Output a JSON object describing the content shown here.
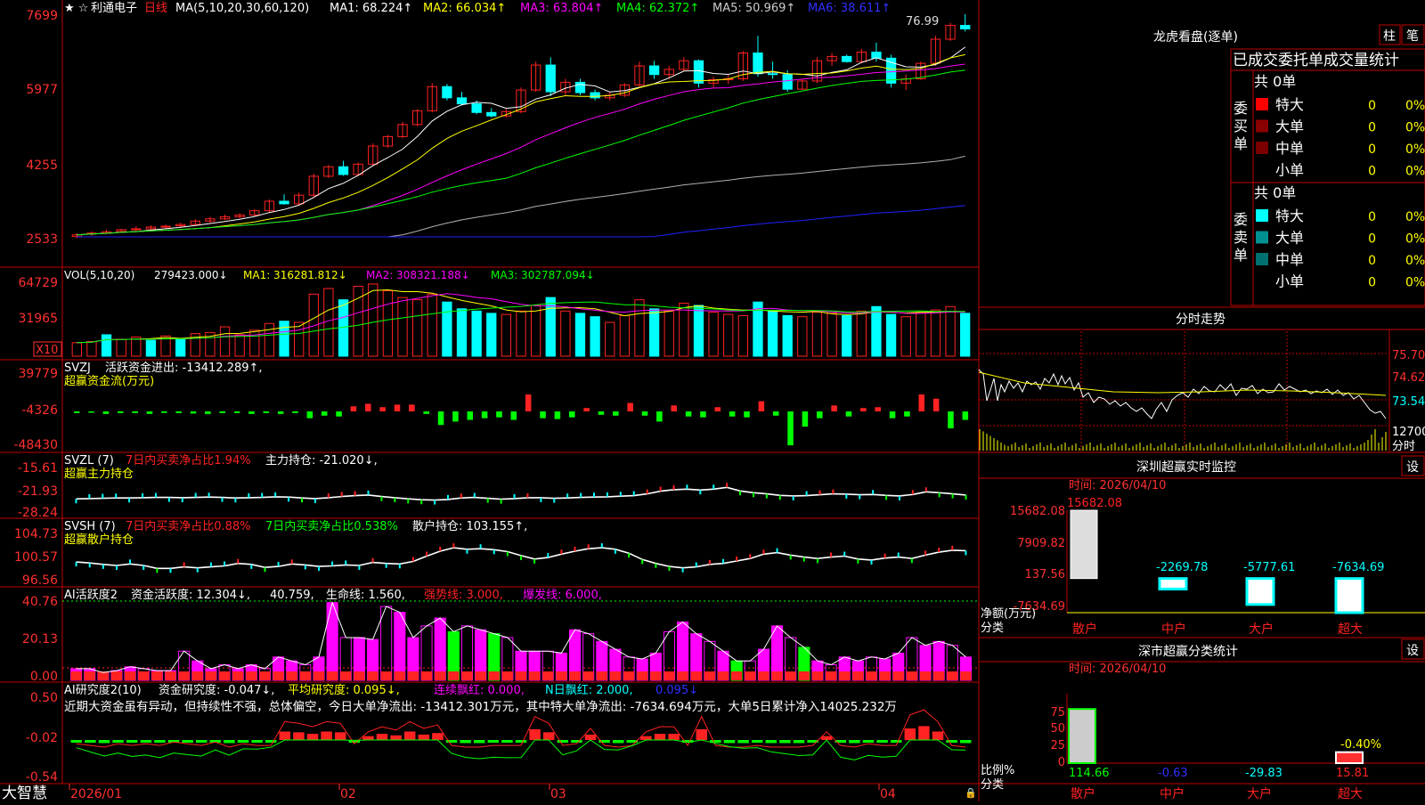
{
  "colors": {
    "up": "#ff2222",
    "down": "#00ffff",
    "panel_border": "#c00000",
    "ma1": "#ffffff",
    "ma2": "#ffff00",
    "ma3": "#ff00ff",
    "ma4": "#00ff00",
    "ma5": "#b0b0b0",
    "ma6": "#2020ff",
    "pink": "#ff00ff",
    "green": "#00ff00",
    "yellow": "#ffff00",
    "cyan": "#00ffff",
    "red": "#ff2222",
    "brown": "#8b0000",
    "teal": "#008080"
  },
  "main_header": {
    "stock_name": "利通电子",
    "period": "日线",
    "ma_params": "MA(5,10,20,30,60,120)",
    "ma1": "MA1: 68.224↑",
    "ma2": "MA2: 66.034↑",
    "ma3": "MA3: 63.804↑",
    "ma4": "MA4: 62.372↑",
    "ma5": "MA5: 50.969↑",
    "ma6": "MA6: 38.611↑",
    "high_label": "76.99"
  },
  "vol_header": {
    "params": "VOL(5,10,20)",
    "value": "279423.000↓",
    "ma1": "MA1: 316281.812↓",
    "ma2": "MA2: 308321.188↓",
    "ma3": "MA3: 302787.094↓",
    "unit": "X10"
  },
  "svzj_header": {
    "name": "SVZJ",
    "label": "活跃资金进出: -13412.289↑,",
    "sub": "超赢资金流(万元)"
  },
  "svzl_header": {
    "name": "SVZL (7)",
    "ratio": "7日内买卖净占比1.94%",
    "hold": "主力持仓: -21.020↓,",
    "sub": "超赢主力持仓"
  },
  "svsh_header": {
    "name": "SVSH (7)",
    "ratio1": "7日内买卖净占比0.88%",
    "ratio2": "7日内买卖净占比0.538%",
    "hold": "散户持仓: 103.155↑,",
    "sub": "超赢散户持仓"
  },
  "ai_header": {
    "name": "AI活跃度2",
    "act": "资金活跃度: 12.304↓,",
    "v2": "40.759,",
    "life": "生命线: 1.560,",
    "strong": "强势线: 3.000,",
    "burst": "爆发线: 6.000,"
  },
  "research_header": {
    "name": "AI研究度2(10)",
    "r1": "资金研究度: -0.047↓,",
    "r2": "平均研究度: 0.095↓,",
    "r3": "连续飘红: 0.000,",
    "r4": "N日飘红: 2.000,",
    "r5": "0.095↓",
    "comment": "近期大资金虽有异动，但持续性不强，总体偏空，今日大单净流出: -13412.301万元，其中特大单净流出: -7634.694万元，大单5日累计净入14025.232万"
  },
  "axes": {
    "price_ticks": [
      "7699",
      "5977",
      "4255",
      "2533"
    ],
    "vol_ticks": [
      "64729",
      "31965"
    ],
    "svzj_ticks": [
      "39779",
      "-4326",
      "-48430"
    ],
    "svzl_ticks": [
      "-15.61",
      "-21.93",
      "-28.24"
    ],
    "svsh_ticks": [
      "104.73",
      "100.57",
      "96.56"
    ],
    "ai_ticks": [
      "40.76",
      "20.13",
      "0.00"
    ],
    "research_ticks": [
      "0.50",
      "-0.02",
      "-0.54"
    ],
    "date_labels": [
      "2026/01",
      "02",
      "03",
      "04"
    ]
  },
  "footer": {
    "brand": "大智慧"
  },
  "dragon": {
    "title": "龙虎看盘(逐单)",
    "btn1": "柱",
    "btn2": "笔",
    "table_title": "已成交委托单成交量统计",
    "buy_label": "委买单",
    "sell_label": "委卖单",
    "buy_total": "共 0单",
    "sell_total": "共 0单",
    "buy_rows": [
      {
        "name": "特大",
        "count": "0",
        "pct": "0%"
      },
      {
        "name": "大单",
        "count": "0",
        "pct": "0%"
      },
      {
        "name": "中单",
        "count": "0",
        "pct": "0%"
      },
      {
        "name": "小单",
        "count": "0",
        "pct": "0%"
      }
    ],
    "sell_rows": [
      {
        "name": "特大",
        "count": "0",
        "pct": "0%"
      },
      {
        "name": "大单",
        "count": "0",
        "pct": "0%"
      },
      {
        "name": "中单",
        "count": "0",
        "pct": "0%"
      },
      {
        "name": "小单",
        "count": "0",
        "pct": "0%"
      }
    ]
  },
  "intraday": {
    "title": "分时走势",
    "ticks": [
      "75.70",
      "74.62",
      "73.54"
    ],
    "vol_label": "12700",
    "vol_unit": "分时"
  },
  "monitor": {
    "title": "深圳超赢实时监控",
    "set": "设",
    "time": "时间: 2026/04/10",
    "unit": "净额(万元)",
    "cat_label": "分类",
    "ticks": [
      "15682.08",
      "7909.82",
      "137.56",
      "-7634.69"
    ],
    "categories": [
      "散户",
      "中户",
      "大户",
      "超大"
    ]
  },
  "classify": {
    "title": "深市超赢分类统计",
    "set": "设",
    "time": "时间: 2026/04/10",
    "unit": "比例%",
    "cat_label": "分类",
    "ticks": [
      "75",
      "50",
      "25",
      "0"
    ],
    "categories": [
      "散户",
      "中户",
      "大户",
      "超大"
    ]
  },
  "chart_data": [
    {
      "type": "candlestick",
      "title": "利通电子 日线",
      "ylim": [
        2533,
        7699
      ],
      "ohlc": [
        [
          2540,
          2620,
          2500,
          2580
        ],
        [
          2600,
          2660,
          2560,
          2620
        ],
        [
          2620,
          2700,
          2590,
          2650
        ],
        [
          2660,
          2720,
          2620,
          2700
        ],
        [
          2700,
          2780,
          2650,
          2720
        ],
        [
          2720,
          2800,
          2680,
          2760
        ],
        [
          2760,
          2820,
          2720,
          2780
        ],
        [
          2790,
          2860,
          2760,
          2820
        ],
        [
          2820,
          2940,
          2800,
          2900
        ],
        [
          2900,
          3000,
          2860,
          2950
        ],
        [
          2950,
          3050,
          2920,
          3000
        ],
        [
          3000,
          3080,
          2960,
          3040
        ],
        [
          3040,
          3180,
          3000,
          3140
        ],
        [
          3140,
          3400,
          3100,
          3360
        ],
        [
          3360,
          3520,
          3280,
          3300
        ],
        [
          3300,
          3560,
          3260,
          3500
        ],
        [
          3500,
          4000,
          3460,
          3940
        ],
        [
          3940,
          4200,
          3900,
          4160
        ],
        [
          4160,
          4300,
          3950,
          3980
        ],
        [
          3980,
          4260,
          3940,
          4220
        ],
        [
          4220,
          4700,
          4180,
          4640
        ],
        [
          4640,
          4900,
          4600,
          4860
        ],
        [
          4860,
          5200,
          4820,
          5140
        ],
        [
          5140,
          5500,
          5100,
          5460
        ],
        [
          5460,
          6100,
          5420,
          6020
        ],
        [
          6020,
          6080,
          5700,
          5760
        ],
        [
          5760,
          5900,
          5580,
          5620
        ],
        [
          5620,
          5700,
          5380,
          5420
        ],
        [
          5420,
          5520,
          5300,
          5340
        ],
        [
          5340,
          5500,
          5300,
          5440
        ],
        [
          5440,
          6000,
          5400,
          5940
        ],
        [
          5940,
          6600,
          5900,
          6520
        ],
        [
          6520,
          6700,
          5800,
          5900
        ],
        [
          5900,
          6200,
          5820,
          6120
        ],
        [
          6120,
          6200,
          5820,
          5880
        ],
        [
          5880,
          5950,
          5700,
          5760
        ],
        [
          5760,
          5900,
          5700,
          5820
        ],
        [
          5820,
          6100,
          5780,
          6060
        ],
        [
          6060,
          6600,
          6020,
          6500
        ],
        [
          6500,
          6620,
          6200,
          6300
        ],
        [
          6300,
          6500,
          6200,
          6420
        ],
        [
          6420,
          6700,
          6380,
          6620
        ],
        [
          6620,
          6650,
          6000,
          6100
        ],
        [
          6100,
          6250,
          6000,
          6180
        ],
        [
          6180,
          6300,
          6080,
          6200
        ],
        [
          6200,
          6850,
          6150,
          6800
        ],
        [
          6800,
          7200,
          6250,
          6320
        ],
        [
          6320,
          6600,
          6200,
          6300
        ],
        [
          6300,
          6400,
          5900,
          5960
        ],
        [
          5960,
          6200,
          5940,
          6150
        ],
        [
          6150,
          6700,
          6100,
          6620
        ],
        [
          6620,
          6800,
          6500,
          6720
        ],
        [
          6720,
          6760,
          6580,
          6600
        ],
        [
          6600,
          6900,
          6560,
          6820
        ],
        [
          6820,
          7040,
          6600,
          6680
        ],
        [
          6680,
          6760,
          6000,
          6100
        ],
        [
          6100,
          6300,
          5940,
          6200
        ],
        [
          6200,
          6600,
          6180,
          6560
        ],
        [
          6560,
          7200,
          6500,
          7120
        ],
        [
          7120,
          7500,
          7080,
          7440
        ],
        [
          7440,
          7699,
          7300,
          7360
        ]
      ]
    },
    {
      "type": "bar",
      "title": "VOL(5,10,20)",
      "values": [
        12000,
        13000,
        19000,
        15000,
        17000,
        14000,
        18000,
        15000,
        20000,
        21000,
        26000,
        19000,
        23000,
        29000,
        31000,
        30000,
        55000,
        60000,
        50000,
        62000,
        64000,
        58000,
        52000,
        50000,
        55000,
        48000,
        42000,
        40000,
        38000,
        37000,
        40000,
        45000,
        52000,
        40000,
        38000,
        35000,
        30000,
        36000,
        50000,
        42000,
        40000,
        47000,
        45000,
        39000,
        37000,
        36000,
        48000,
        40000,
        36000,
        35000,
        39000,
        38000,
        36000,
        40000,
        44000,
        37000,
        35000,
        39000,
        41000,
        44000,
        38000
      ],
      "up": [
        true,
        true,
        false,
        true,
        true,
        false,
        true,
        false,
        true,
        true,
        true,
        true,
        true,
        true,
        false,
        true,
        true,
        true,
        false,
        true,
        true,
        true,
        true,
        true,
        true,
        false,
        false,
        false,
        false,
        true,
        true,
        true,
        false,
        true,
        false,
        false,
        true,
        true,
        true,
        false,
        true,
        true,
        false,
        true,
        true,
        true,
        false,
        false,
        false,
        true,
        true,
        true,
        false,
        true,
        false,
        false,
        true,
        true,
        true,
        true,
        false
      ]
    },
    {
      "type": "bar",
      "title": "SVZJ",
      "values": [
        -2000,
        -1500,
        -3000,
        -2000,
        -2000,
        -3000,
        -1800,
        -2000,
        -2500,
        -3000,
        -2000,
        -2000,
        -3000,
        -2000,
        -3000,
        -2000,
        -8000,
        -5000,
        -6000,
        6000,
        9000,
        5000,
        8000,
        8000,
        -3000,
        -16000,
        -12000,
        -10000,
        -8000,
        -7000,
        -10000,
        20000,
        -8000,
        -9000,
        -7000,
        4000,
        -4000,
        -5000,
        10000,
        -5000,
        -12000,
        7000,
        -6000,
        -7000,
        5000,
        -6000,
        -7000,
        12000,
        -5000,
        -40000,
        -18000,
        -8000,
        7000,
        -6000,
        4000,
        5000,
        -8000,
        -6000,
        20000,
        15000,
        -20000,
        -10000
      ]
    },
    {
      "type": "line",
      "title": "SVZL (7)",
      "values": [
        -22.9,
        -22.8,
        -22.7,
        -22.6,
        -22.6,
        -22.5,
        -22.4,
        -22.4,
        -22.5,
        -22.4,
        -22.3,
        -22.4,
        -22.6,
        -22.5,
        -22.4,
        -22.2,
        -22.3,
        -22.6,
        -22.8,
        -22.5,
        -22.1,
        -21.8,
        -21.6,
        -22.1,
        -22.5,
        -22.9,
        -23.2,
        -23.3,
        -23.1,
        -22.6,
        -22.4,
        -22.7,
        -23.0,
        -22.8,
        -22.5,
        -22.5,
        -22.7,
        -22.6,
        -22.4,
        -22.3,
        -22.2,
        -22.0,
        -21.8,
        -21.2,
        -20.3,
        -19.8,
        -19.6,
        -19.9,
        -19.6,
        -19.0,
        -20.2,
        -20.8,
        -21.2,
        -21.7,
        -21.9,
        -21.8,
        -21.5,
        -21.2,
        -21.3,
        -21.5,
        -21.4,
        -21.7,
        -21.9,
        -21.4,
        -20.5,
        -20.8,
        -21.2,
        -21.6
      ]
    },
    {
      "type": "line",
      "title": "SVSH (7)",
      "values": [
        100.9,
        100.7,
        100.4,
        100.2,
        100.5,
        100.2,
        99.6,
        99.6,
        99.9,
        99.7,
        99.9,
        100.1,
        100.6,
        100.4,
        99.8,
        100.0,
        100.5,
        100.3,
        100.0,
        100.1,
        100.3,
        100.2,
        100.8,
        100.6,
        100.5,
        101.0,
        102.1,
        103.1,
        103.8,
        103.5,
        103.6,
        103.4,
        103.0,
        102.2,
        101.5,
        101.8,
        102.5,
        103.1,
        103.6,
        103.8,
        103.5,
        102.7,
        101.4,
        100.6,
        100.0,
        99.7,
        99.9,
        100.4,
        100.6,
        101.1,
        101.6,
        102.5,
        102.8,
        102.3,
        101.9,
        101.6,
        101.9,
        102.1,
        101.5,
        101.3,
        101.7,
        101.9,
        101.6,
        102.3,
        102.9,
        103.3,
        103.2
      ]
    },
    {
      "type": "bar",
      "title": "AI活跃度2",
      "values": [
        6,
        6,
        4,
        5,
        7,
        6,
        5,
        5,
        15,
        10,
        6,
        8,
        6,
        8,
        6,
        12,
        10,
        8,
        12,
        40,
        22,
        22,
        21,
        38,
        35,
        22,
        28,
        32,
        25,
        28,
        26,
        24,
        22,
        15,
        15,
        15,
        14,
        26,
        24,
        20,
        16,
        12,
        11,
        14,
        25,
        30,
        24,
        20,
        15,
        10,
        10,
        16,
        28,
        22,
        17,
        10,
        8,
        12,
        10,
        12,
        11,
        14,
        22,
        18,
        20,
        18,
        12
      ],
      "green": [
        false,
        false,
        false,
        false,
        false,
        false,
        false,
        false,
        false,
        false,
        false,
        false,
        false,
        false,
        false,
        false,
        false,
        false,
        false,
        false,
        false,
        false,
        false,
        false,
        false,
        false,
        false,
        false,
        true,
        false,
        false,
        true,
        false,
        false,
        false,
        false,
        false,
        false,
        false,
        false,
        false,
        false,
        false,
        false,
        false,
        false,
        false,
        false,
        false,
        true,
        false,
        false,
        false,
        false,
        true,
        false,
        false,
        false,
        false,
        false,
        false,
        false,
        false,
        false,
        false,
        false,
        false
      ]
    },
    {
      "type": "bar",
      "title": "AI研究度2(10)",
      "values": [
        -0.04,
        -0.05,
        -0.06,
        -0.04,
        -0.05,
        -0.04,
        -0.05,
        -0.03,
        -0.04,
        -0.05,
        -0.03,
        -0.06,
        -0.04,
        -0.05,
        -0.05,
        0.09,
        0.08,
        0.06,
        0.09,
        0.08,
        -0.04,
        0.03,
        0.06,
        0.04,
        0.09,
        0.05,
        0.07,
        -0.05,
        -0.06,
        -0.06,
        -0.05,
        -0.05,
        -0.05,
        0.12,
        0.08,
        -0.05,
        -0.04,
        0.05,
        -0.05,
        -0.06,
        -0.05,
        0.03,
        0.06,
        0.06,
        -0.05,
        0.12,
        -0.05,
        -0.06,
        -0.06,
        -0.05,
        -0.06,
        -0.06,
        -0.06,
        -0.05,
        0.03,
        -0.05,
        -0.06,
        -0.04,
        -0.05,
        -0.05,
        0.13,
        0.16,
        0.09,
        -0.05,
        -0.06
      ]
    },
    {
      "type": "bar",
      "title": "深圳超赢实时监控",
      "categories": [
        "散户",
        "中户",
        "大户",
        "超大"
      ],
      "values": [
        15682.08,
        -2269.78,
        -5777.61,
        -7634.69
      ]
    },
    {
      "type": "bar",
      "title": "深市超赢分类统计",
      "categories": [
        "散户",
        "中户",
        "大户",
        "超大"
      ],
      "values": [
        114.66,
        -0.63,
        -29.83,
        15.81
      ],
      "annotation": "-0.40%"
    }
  ]
}
